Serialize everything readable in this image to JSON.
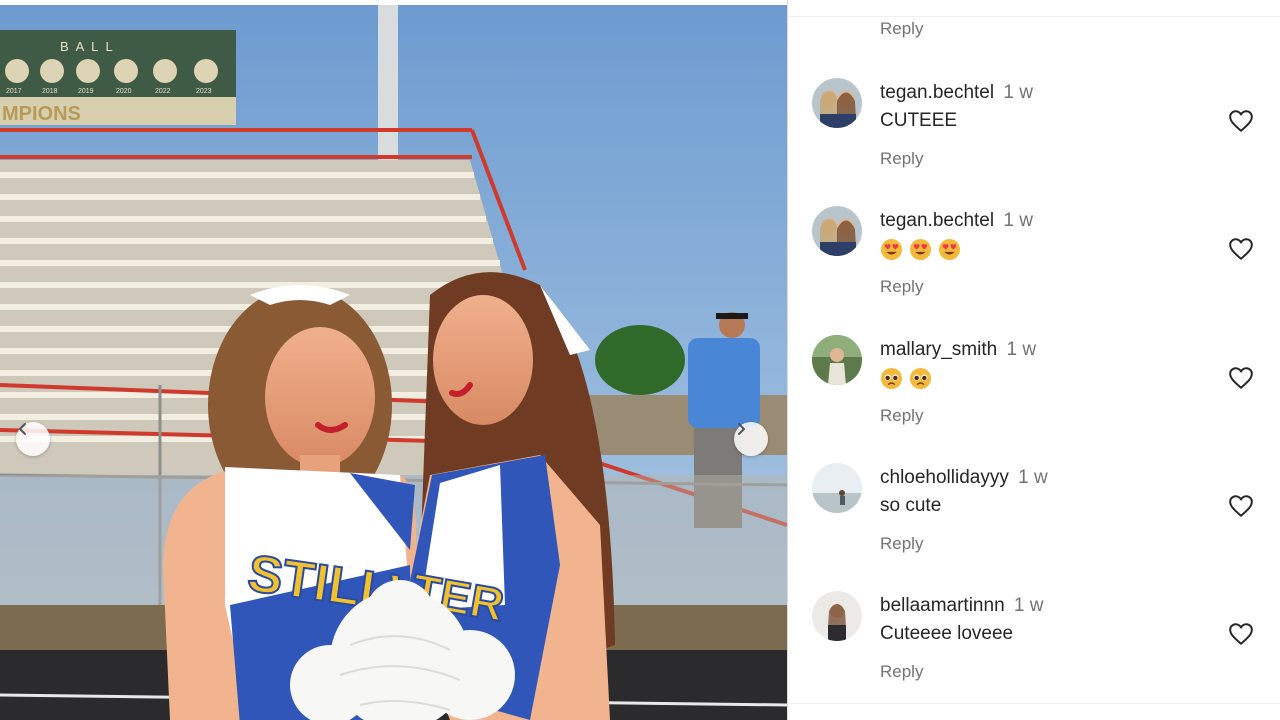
{
  "photo": {
    "scoreboard_letters": "B A L L",
    "scoreboard_years": [
      "2017",
      "2018",
      "2019",
      "2020",
      "2022",
      "2023"
    ],
    "scoreboard_banner": "MPIONS",
    "uniform_left_text": "STILLW",
    "uniform_right_text": "TER",
    "prev_icon": "chevron-left-icon",
    "next_icon": "chevron-right-icon"
  },
  "comments_panel": {
    "top_reply_label": "Reply",
    "items": [
      {
        "username": "tegan.bechtel",
        "time": "1 w",
        "text": "CUTEEE",
        "emojis": [],
        "reply_label": "Reply",
        "avatar_icon": "avatar-photo-icon",
        "like_icon": "heart-outline-icon"
      },
      {
        "username": "tegan.bechtel",
        "time": "1 w",
        "text": "",
        "emojis": [
          "heart-eyes-emoji",
          "heart-eyes-emoji",
          "heart-eyes-emoji"
        ],
        "reply_label": "Reply",
        "avatar_icon": "avatar-photo-icon",
        "like_icon": "heart-outline-icon"
      },
      {
        "username": "mallary_smith",
        "time": "1 w",
        "text": "",
        "emojis": [
          "pleading-face-emoji",
          "pleading-face-emoji"
        ],
        "reply_label": "Reply",
        "avatar_icon": "avatar-photo-icon",
        "like_icon": "heart-outline-icon"
      },
      {
        "username": "chloehollidayyy",
        "time": "1 w",
        "text": "so cute",
        "emojis": [],
        "reply_label": "Reply",
        "avatar_icon": "avatar-photo-icon",
        "like_icon": "heart-outline-icon"
      },
      {
        "username": "bellaamartinnn",
        "time": "1 w",
        "text": "Cuteeee loveee",
        "emojis": [],
        "reply_label": "Reply",
        "avatar_icon": "avatar-photo-icon",
        "like_icon": "heart-outline-icon"
      }
    ]
  },
  "colors": {
    "username": "#262626",
    "muted": "#737373",
    "divider": "#dbdbdb",
    "uniform_blue": "#2f56b8",
    "uniform_gold": "#f2c12e"
  }
}
